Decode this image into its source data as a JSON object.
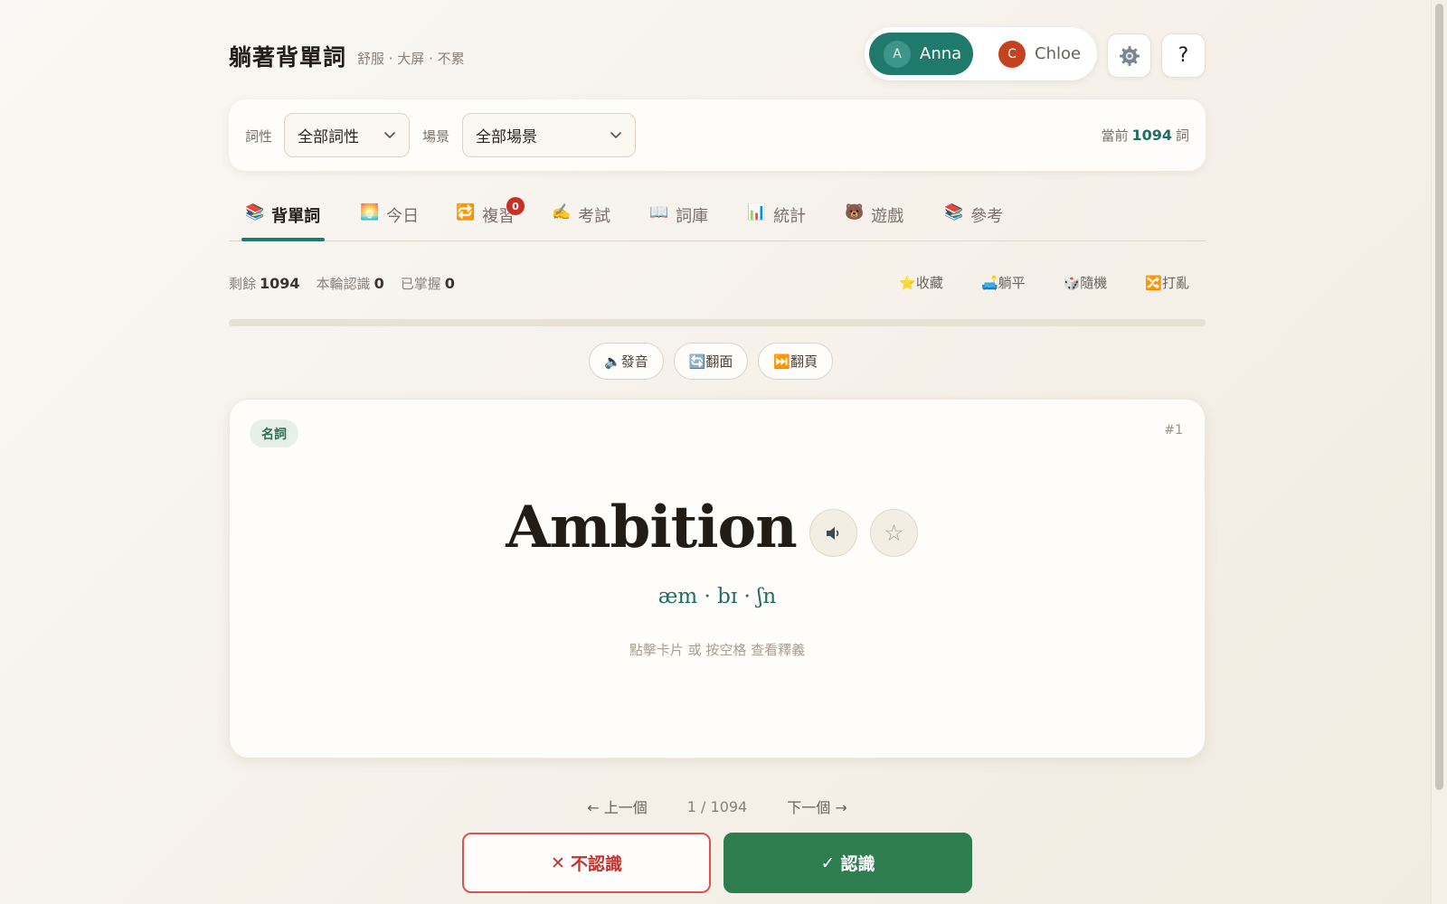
{
  "app": {
    "title": "躺著背單詞",
    "subtitle": "舒服 · 大屏 · 不累"
  },
  "users": [
    {
      "initial": "A",
      "name": "Anna",
      "active": true,
      "color": "#1f7a6c"
    },
    {
      "initial": "C",
      "name": "Chloe",
      "active": false,
      "color": "#c5421e"
    }
  ],
  "header": {
    "settings_icon": "gear-icon",
    "help_label": "?"
  },
  "filters": {
    "pos_label": "詞性",
    "pos_value": "全部詞性",
    "scene_label": "場景",
    "scene_value": "全部場景",
    "current_prefix": "當前",
    "current_count": "1094",
    "current_suffix": "詞"
  },
  "tabs": [
    {
      "icon": "📚",
      "label": "背單詞"
    },
    {
      "icon": "🌅",
      "label": "今日"
    },
    {
      "icon": "🔁",
      "label": "複習",
      "badge": "0"
    },
    {
      "icon": "✍️",
      "label": "考試"
    },
    {
      "icon": "📖",
      "label": "詞庫"
    },
    {
      "icon": "📊",
      "label": "統計"
    },
    {
      "icon": "🐻",
      "label": "遊戲"
    },
    {
      "icon": "📚",
      "label": "參考"
    }
  ],
  "stats": {
    "remaining_label": "剩餘",
    "remaining_value": "1094",
    "known_label": "本輪認識",
    "known_value": "0",
    "mastered_label": "已掌握",
    "mastered_value": "0"
  },
  "mini_actions": {
    "favorite": "⭐收藏",
    "lie_flat": "🛋️躺平",
    "random": "🎲隨機",
    "shuffle": "🔀打亂"
  },
  "progress": {
    "fraction": 0
  },
  "controls": {
    "speak": "🔈發音",
    "flip": "🔄翻面",
    "page": "⏭️翻頁"
  },
  "card": {
    "pos_tag": "名詞",
    "index": "#1",
    "word": "Ambition",
    "phonetic": "æm · bɪ · ʃn",
    "hint": "點擊卡片 或 按空格 查看釋義",
    "speak_icon": "speaker-icon",
    "star_icon": "☆"
  },
  "pager": {
    "prev": "← 上一個",
    "position": "1 / 1094",
    "next": "下一個 →"
  },
  "answers": {
    "unknown_symbol": "✕",
    "unknown_label": "不認識",
    "known_symbol": "✓",
    "known_label": "認識"
  },
  "colors": {
    "accent": "#1f7a6c",
    "danger": "#c93127",
    "success": "#2e7d4f"
  }
}
